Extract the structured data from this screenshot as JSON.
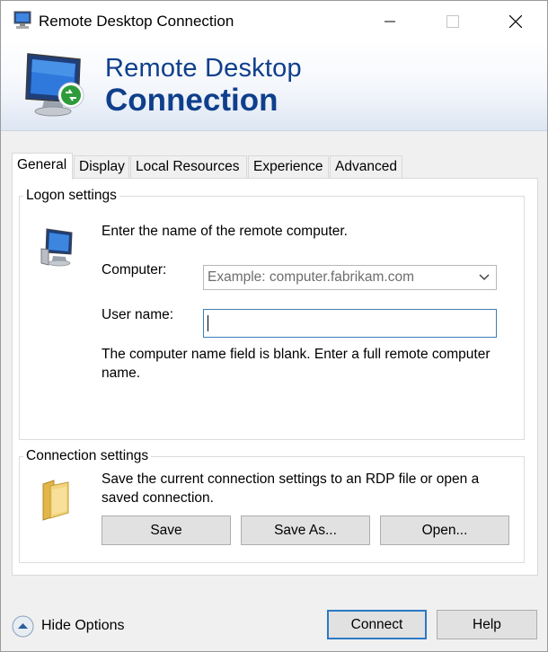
{
  "window": {
    "title": "Remote Desktop Connection",
    "caption_buttons": [
      "minimize-icon",
      "maximize-icon",
      "close-icon"
    ]
  },
  "banner": {
    "line1": "Remote Desktop",
    "line2": "Connection"
  },
  "tabs": [
    {
      "label": "General",
      "active": true
    },
    {
      "label": "Display",
      "active": false
    },
    {
      "label": "Local Resources",
      "active": false
    },
    {
      "label": "Experience",
      "active": false
    },
    {
      "label": "Advanced",
      "active": false
    }
  ],
  "logon": {
    "legend": "Logon settings",
    "instruction": "Enter the name of the remote computer.",
    "computer_label": "Computer:",
    "computer_placeholder": "Example: computer.fabrikam.com",
    "computer_value": "",
    "username_label": "User name:",
    "username_value": "",
    "warning": "The computer name field is blank. Enter a full remote computer name."
  },
  "connection": {
    "legend": "Connection settings",
    "description": "Save the current connection settings to an RDP file or open a saved connection.",
    "save_label": "Save",
    "save_as_label": "Save As...",
    "open_label": "Open..."
  },
  "footer": {
    "hide_options_label": "Hide Options",
    "connect_label": "Connect",
    "help_label": "Help"
  },
  "colors": {
    "banner_text": "#0f3f8c",
    "focus_border": "#3b7fb6",
    "default_button_border": "#2b79c4"
  }
}
